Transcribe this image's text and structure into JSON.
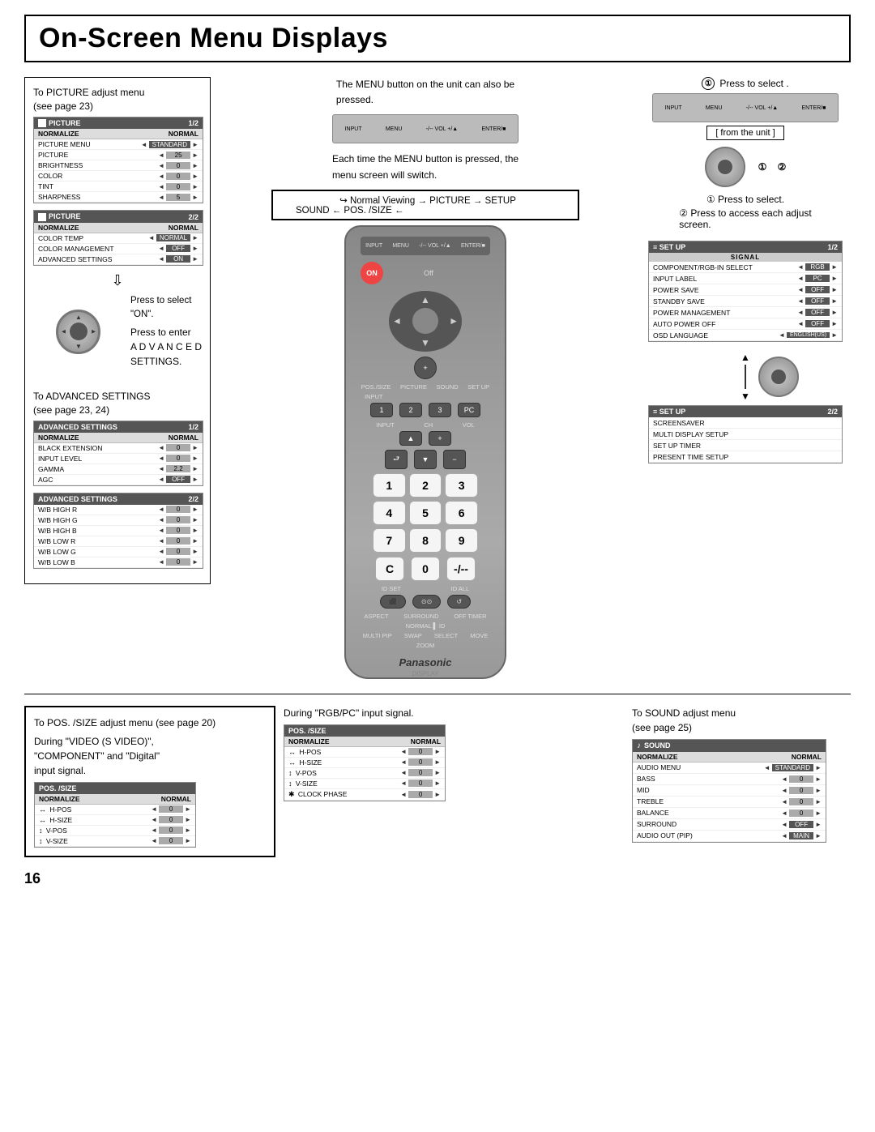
{
  "page": {
    "title": "On-Screen Menu Displays",
    "page_number": "16"
  },
  "left_section": {
    "picture_text": "To PICTURE adjust menu\n(see page 23)",
    "picture_menu_1": {
      "title": "PICTURE",
      "page": "1/2",
      "normalize": "NORMALIZE",
      "normalize_val": "NORMAL",
      "rows": [
        {
          "label": "PICTURE MENU",
          "value": "STANDARD"
        },
        {
          "label": "PICTURE",
          "value": "25"
        },
        {
          "label": "BRIGHTNESS",
          "value": "0"
        },
        {
          "label": "COLOR",
          "value": "0"
        },
        {
          "label": "TINT",
          "value": "0"
        },
        {
          "label": "SHARPNESS",
          "value": "5"
        }
      ]
    },
    "picture_menu_2": {
      "title": "PICTURE",
      "page": "2/2",
      "normalize": "NORMALIZE",
      "normalize_val": "NORMAL",
      "rows": [
        {
          "label": "COLOR TEMP",
          "value": "NORMAL"
        },
        {
          "label": "COLOR MANAGEMENT",
          "value": "OFF"
        },
        {
          "label": "ADVANCED SETTINGS",
          "value": "ON"
        }
      ]
    },
    "press_select_on": "Press to select\n\"ON\".",
    "press_enter": "Press to enter\nA D V A N C E D\nSETTINGS.",
    "advanced_text": "To ADVANCED SETTINGS\n(see page 23, 24)",
    "advanced_menu_1": {
      "title": "ADVANCED SETTINGS",
      "page": "1/2",
      "normalize": "NORMALIZE",
      "normalize_val": "NORMAL",
      "rows": [
        {
          "label": "BLACK EXTENSION",
          "value": "0"
        },
        {
          "label": "INPUT LEVEL",
          "value": "0"
        },
        {
          "label": "GAMMA",
          "value": "2.2"
        },
        {
          "label": "AGC",
          "value": "OFF"
        }
      ]
    },
    "advanced_menu_2": {
      "title": "ADVANCED SETTINGS",
      "page": "2/2",
      "rows": [
        {
          "label": "W/B HIGH R",
          "value": "0"
        },
        {
          "label": "W/B HIGH G",
          "value": "0"
        },
        {
          "label": "W/B HIGH B",
          "value": "0"
        },
        {
          "label": "W/B LOW R",
          "value": "0"
        },
        {
          "label": "W/B LOW G",
          "value": "0"
        },
        {
          "label": "W/B LOW B",
          "value": "0"
        }
      ]
    }
  },
  "center_section": {
    "instr_line1": "The MENU button on the unit can also be",
    "instr_line2": "pressed.",
    "instr_line3": "Each time the MENU button is pressed, the",
    "instr_line4": "menu screen will switch.",
    "flow_label": "Normal Viewing → PICTURE → SETUP",
    "flow_label2": "SOUND ← POS. /SIZE ←",
    "remote_labels": {
      "top_bar": [
        "INPUT",
        "MENU",
        "-/-- VOL +/▲",
        "ENTER/■"
      ],
      "on_label": "ON",
      "off_label": "Off",
      "pos_size": "POS./SIZE",
      "picture": "PICTURE",
      "sound": "SOUND",
      "setup": "SET UP",
      "input_label": "INPUT",
      "ch_label": "CH",
      "vol_label": "VOL",
      "num_buttons": [
        "1",
        "2",
        "3",
        "PC",
        "1",
        "2",
        "3",
        "4",
        "5",
        "6",
        "7",
        "8",
        "9",
        "C",
        "0",
        "-/--"
      ],
      "id_set": "ID SET",
      "id_all": "ID ALL",
      "aspect": "ASPECT",
      "surround": "SURROUND",
      "off_timer": "OFF TIMER",
      "normal": "NORMAL",
      "id": "ID",
      "multi_pip": "MULTI PIP",
      "swap": "SWAP",
      "select": "SELECT",
      "move": "MOVE",
      "zoom": "ZOOM",
      "brand": "Panasonic",
      "display": "DISPLAY"
    }
  },
  "right_section": {
    "press_select_text": "① Press to select .",
    "from_unit_label": "[ from the unit ]",
    "step1": "① Press to select.",
    "step2": "② Press to access each adjust\n   screen.",
    "setup_menu_1": {
      "title": "SET UP",
      "page": "1/2",
      "signal_label": "SIGNAL",
      "component_label": "COMPONENT/RGB-IN SELECT",
      "rows": [
        {
          "label": "COMPONENT/RGB-IN SELECT",
          "value": "RGB"
        },
        {
          "label": "INPUT LABEL",
          "value": "PC"
        },
        {
          "label": "POWER SAVE",
          "value": "OFF"
        },
        {
          "label": "STANDBY SAVE",
          "value": "OFF"
        },
        {
          "label": "POWER MANAGEMENT",
          "value": "OFF"
        },
        {
          "label": "AUTO POWER OFF",
          "value": "OFF"
        },
        {
          "label": "OSD LANGUAGE",
          "value": "ENGLISH(US)"
        }
      ]
    },
    "setup_menu_2": {
      "title": "SET UP",
      "page": "2/2",
      "rows": [
        {
          "label": "SCREENSAVER",
          "value": ""
        },
        {
          "label": "MULTI DISPLAY SETUP",
          "value": ""
        },
        {
          "label": "SET UP TIMER",
          "value": ""
        },
        {
          "label": "PRESENT TIME SETUP",
          "value": ""
        }
      ]
    }
  },
  "bottom_section": {
    "pos_size_text_title": "To POS. /SIZE adjust menu (see page 20)",
    "pos_size_text2_title": "During \"VIDEO (S VIDEO)\",",
    "pos_size_text2_subtitle": "\"COMPONENT\" and \"Digital\"",
    "pos_size_text2_body": "input signal.",
    "pos_size_text3_title": "During \"RGB/PC\" input signal.",
    "pos_size_menu_1": {
      "title": "POS. /SIZE",
      "normalize": "NORMALIZE",
      "normalize_val": "NORMAL",
      "rows": [
        {
          "label": "H-POS",
          "value": "0",
          "icon": "↔"
        },
        {
          "label": "H-SIZE",
          "value": "0",
          "icon": "↔"
        },
        {
          "label": "V-POS",
          "value": "0",
          "icon": "↕"
        },
        {
          "label": "V-SIZE",
          "value": "0",
          "icon": "↕"
        }
      ]
    },
    "pos_size_menu_2": {
      "title": "POS. /SIZE",
      "normalize": "NORMALIZE",
      "normalize_val": "NORMAL",
      "rows": [
        {
          "label": "H-POS",
          "value": "0",
          "icon": "↔"
        },
        {
          "label": "H-SIZE",
          "value": "0",
          "icon": "↔"
        },
        {
          "label": "V-POS",
          "value": "0",
          "icon": "↕"
        },
        {
          "label": "V-SIZE",
          "value": "0",
          "icon": "↕"
        },
        {
          "label": "CLOCK PHASE",
          "value": "0",
          "icon": "✱"
        }
      ]
    },
    "sound_text_title": "To SOUND adjust menu",
    "sound_text_subtitle": "(see page 25)",
    "sound_menu": {
      "title": "SOUND",
      "normalize": "NORMALIZE",
      "normalize_val": "NORMAL",
      "rows": [
        {
          "label": "AUDIO MENU",
          "value": "STANDARD"
        },
        {
          "label": "BASS",
          "value": "0"
        },
        {
          "label": "MID",
          "value": "0"
        },
        {
          "label": "TREBLE",
          "value": "0"
        },
        {
          "label": "BALANCE",
          "value": "0"
        },
        {
          "label": "SURROUND",
          "value": "OFF"
        },
        {
          "label": "AUDIO OUT (PIP)",
          "value": "MAIN"
        }
      ]
    }
  }
}
